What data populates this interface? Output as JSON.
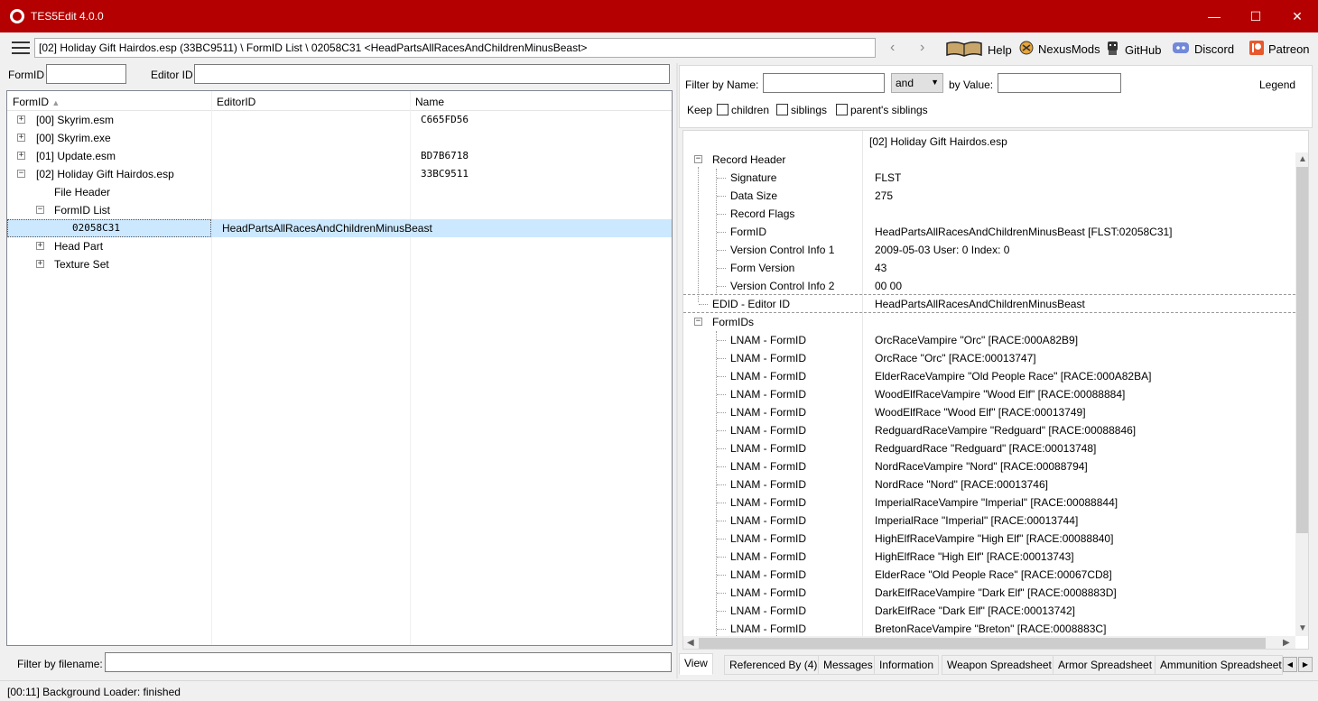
{
  "window": {
    "title": "TES5Edit 4.0.0",
    "controls": {
      "minimize": "—",
      "maximize": "☐",
      "close": "✕"
    }
  },
  "toolbar": {
    "path": "[02] Holiday Gift Hairdos.esp (33BC9511) \\ FormID List \\ 02058C31 <HeadPartsAllRacesAndChildrenMinusBeast>",
    "back": "‹",
    "forward": "›",
    "links": [
      {
        "icon": "book-icon",
        "label": "Help"
      },
      {
        "icon": "nexusmods-icon",
        "label": "NexusMods"
      },
      {
        "icon": "github-icon",
        "label": "GitHub"
      },
      {
        "icon": "discord-icon",
        "label": "Discord"
      },
      {
        "icon": "patreon-icon",
        "label": "Patreon"
      }
    ]
  },
  "left": {
    "formid_label": "FormID",
    "formid_value": "",
    "editorid_label": "Editor ID",
    "editorid_value": "",
    "columns": [
      "FormID",
      "EditorID",
      "Name"
    ],
    "sort_indicator": "▲",
    "rows": [
      {
        "expander": "+",
        "formid": "[00] Skyrim.esm",
        "editorid": "",
        "name": "C665FD56"
      },
      {
        "expander": "+",
        "formid": "[00] Skyrim.exe",
        "editorid": "",
        "name": ""
      },
      {
        "expander": "+",
        "formid": "[01] Update.esm",
        "editorid": "",
        "name": "BD7B6718"
      },
      {
        "expander": "−",
        "formid": "[02] Holiday Gift Hairdos.esp",
        "editorid": "",
        "name": "33BC9511"
      },
      {
        "expander": "",
        "formid": "File Header",
        "editorid": "",
        "name": ""
      },
      {
        "expander": "−",
        "formid": "FormID List",
        "editorid": "",
        "name": ""
      },
      {
        "expander": "",
        "formid": "02058C31",
        "editorid": "HeadPartsAllRacesAndChildrenMinusBeast",
        "name": ""
      },
      {
        "expander": "+",
        "formid": "Head Part",
        "editorid": "",
        "name": ""
      },
      {
        "expander": "+",
        "formid": "Texture Set",
        "editorid": "",
        "name": ""
      }
    ],
    "filter_label": "Filter by filename:",
    "filter_value": ""
  },
  "right": {
    "filter_name_label": "Filter by Name:",
    "filter_name_value": "",
    "operator": "and",
    "filter_value_label": "by Value:",
    "filter_value_value": "",
    "legend": "Legend",
    "keep_label": "Keep",
    "keep_options": [
      "children",
      "siblings",
      "parent's siblings"
    ],
    "file_header": "[02] Holiday Gift Hairdos.esp",
    "record_header": "Record Header",
    "header_rows": [
      {
        "label": "Signature",
        "value": "FLST"
      },
      {
        "label": "Data Size",
        "value": "275"
      },
      {
        "label": "Record Flags",
        "value": ""
      },
      {
        "label": "FormID",
        "value": "HeadPartsAllRacesAndChildrenMinusBeast [FLST:02058C31]"
      },
      {
        "label": "Version Control Info 1",
        "value": "2009-05-03 User: 0 Index: 0"
      },
      {
        "label": "Form Version",
        "value": "43"
      },
      {
        "label": "Version Control Info 2",
        "value": "00 00"
      }
    ],
    "edid": {
      "label": "EDID - Editor ID",
      "value": "HeadPartsAllRacesAndChildrenMinusBeast"
    },
    "formids_label": "FormIDs",
    "formid_rows": [
      {
        "label": "LNAM - FormID",
        "value": "OrcRaceVampire \"Orc\" [RACE:000A82B9]"
      },
      {
        "label": "LNAM - FormID",
        "value": "OrcRace \"Orc\" [RACE:00013747]"
      },
      {
        "label": "LNAM - FormID",
        "value": "ElderRaceVampire \"Old People Race\" [RACE:000A82BA]"
      },
      {
        "label": "LNAM - FormID",
        "value": "WoodElfRaceVampire \"Wood Elf\" [RACE:00088884]"
      },
      {
        "label": "LNAM - FormID",
        "value": "WoodElfRace \"Wood Elf\" [RACE:00013749]"
      },
      {
        "label": "LNAM - FormID",
        "value": "RedguardRaceVampire \"Redguard\" [RACE:00088846]"
      },
      {
        "label": "LNAM - FormID",
        "value": "RedguardRace \"Redguard\" [RACE:00013748]"
      },
      {
        "label": "LNAM - FormID",
        "value": "NordRaceVampire \"Nord\" [RACE:00088794]"
      },
      {
        "label": "LNAM - FormID",
        "value": "NordRace \"Nord\" [RACE:00013746]"
      },
      {
        "label": "LNAM - FormID",
        "value": "ImperialRaceVampire \"Imperial\" [RACE:00088844]"
      },
      {
        "label": "LNAM - FormID",
        "value": "ImperialRace \"Imperial\" [RACE:00013744]"
      },
      {
        "label": "LNAM - FormID",
        "value": "HighElfRaceVampire \"High Elf\" [RACE:00088840]"
      },
      {
        "label": "LNAM - FormID",
        "value": "HighElfRace \"High Elf\" [RACE:00013743]"
      },
      {
        "label": "LNAM - FormID",
        "value": "ElderRace \"Old People Race\" [RACE:00067CD8]"
      },
      {
        "label": "LNAM - FormID",
        "value": "DarkElfRaceVampire \"Dark Elf\" [RACE:0008883D]"
      },
      {
        "label": "LNAM - FormID",
        "value": "DarkElfRace \"Dark Elf\" [RACE:00013742]"
      },
      {
        "label": "LNAM - FormID",
        "value": "BretonRaceVampire \"Breton\" [RACE:0008883C]"
      }
    ],
    "tabs": [
      "View",
      "Referenced By (4)",
      "Messages",
      "Information",
      "Weapon Spreadsheet",
      "Armor Spreadsheet",
      "Ammunition Spreadsheet"
    ]
  },
  "status": "[00:11] Background Loader: finished",
  "colors": {
    "titlebar": "#b40000",
    "selection": "#cce8ff"
  }
}
